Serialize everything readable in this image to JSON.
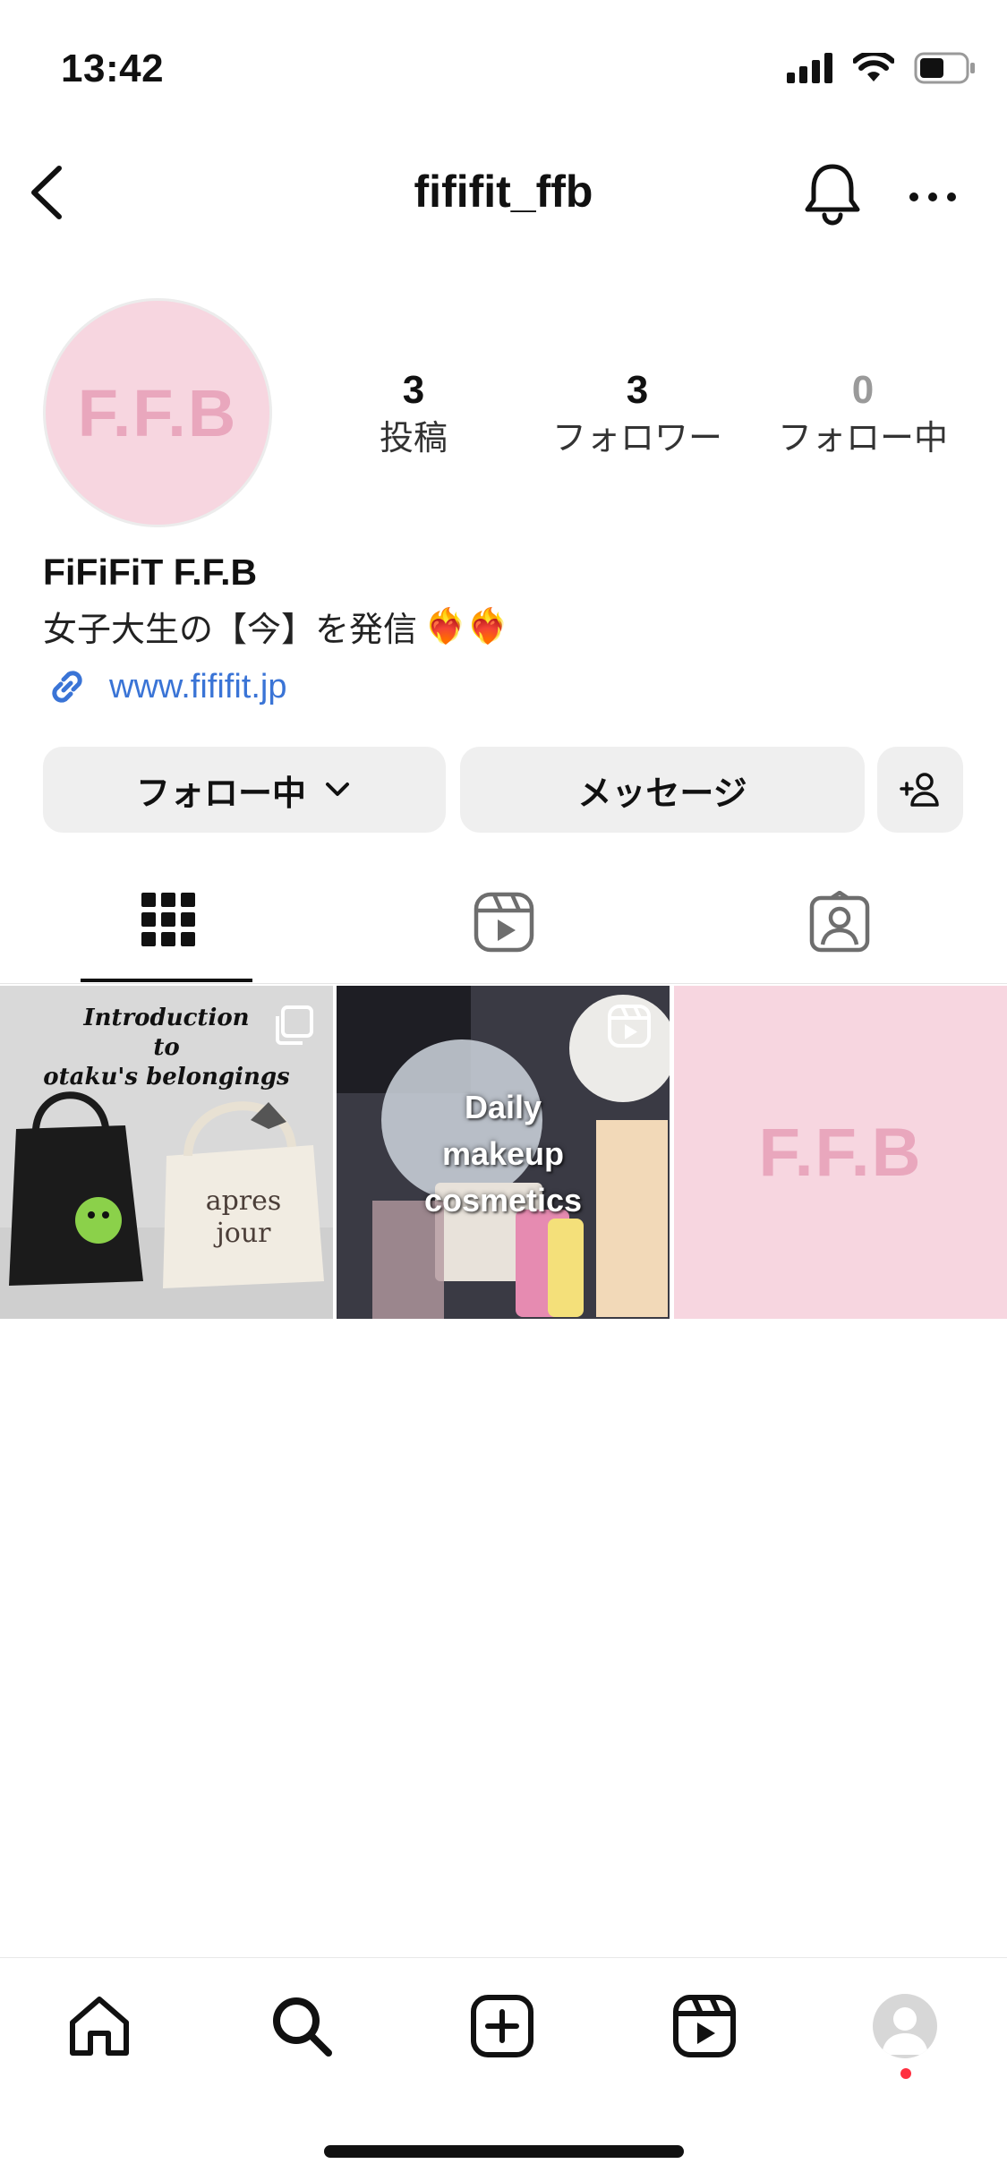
{
  "status_bar": {
    "time": "13:42"
  },
  "header": {
    "username": "fififit_ffb"
  },
  "profile": {
    "avatar_text": "F.F.B",
    "stats": [
      {
        "value": "3",
        "label": "投稿"
      },
      {
        "value": "3",
        "label": "フォロワー"
      },
      {
        "value": "0",
        "label": "フォロー中"
      }
    ],
    "display_name": "FiFiFiT F.F.B",
    "bio": "女子大生の【今】を発信",
    "bio_emojis": "❤️‍🔥❤️‍🔥",
    "link": "www.fififit.jp"
  },
  "buttons": {
    "following": "フォロー中",
    "message": "メッセージ"
  },
  "tabs": [
    "posts-grid",
    "reels",
    "tagged"
  ],
  "posts": [
    {
      "caption_lines": [
        "Introduction",
        "to",
        "otaku's belongings"
      ],
      "badge": "carousel-icon"
    },
    {
      "caption_lines": [
        "Daily",
        "makeup",
        "cosmetics"
      ],
      "badge": "reels-icon"
    },
    {
      "text": "F.F.B"
    }
  ],
  "colors": {
    "accent_link": "#3a74d6",
    "brand_pink": "#f7d6e0",
    "brand_pink_text": "#e9a7bd",
    "notification_dot": "#ff3040"
  }
}
